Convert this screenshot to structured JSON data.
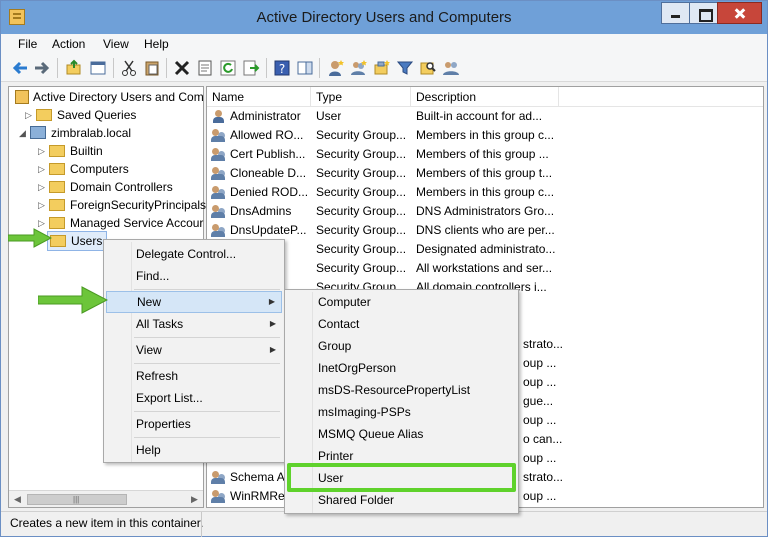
{
  "window": {
    "title": "Active Directory Users and Computers"
  },
  "menu": [
    "File",
    "Action",
    "View",
    "Help"
  ],
  "tree": {
    "root": "Active Directory Users and Com",
    "saved_queries": "Saved Queries",
    "domain": "zimbralab.local",
    "children": [
      "Builtin",
      "Computers",
      "Domain Controllers",
      "ForeignSecurityPrincipals",
      "Managed Service Accour"
    ],
    "selected": "Users"
  },
  "list": {
    "columns": [
      "Name",
      "Type",
      "Description"
    ],
    "rows": [
      {
        "name": "Administrator",
        "type": "User",
        "desc": "Built-in account for ad..."
      },
      {
        "name": "Allowed RO...",
        "type": "Security Group...",
        "desc": "Members in this group c..."
      },
      {
        "name": "Cert Publish...",
        "type": "Security Group...",
        "desc": "Members of this group ..."
      },
      {
        "name": "Cloneable D...",
        "type": "Security Group...",
        "desc": "Members of this group t..."
      },
      {
        "name": "Denied ROD...",
        "type": "Security Group...",
        "desc": "Members in this group c..."
      },
      {
        "name": "DnsAdmins",
        "type": "Security Group...",
        "desc": "DNS Administrators Gro..."
      },
      {
        "name": "DnsUpdateP...",
        "type": "Security Group...",
        "desc": "DNS clients who are per..."
      },
      {
        "name": "",
        "type": "Security Group...",
        "desc": "Designated administrato..."
      },
      {
        "name": "",
        "type": "Security Group...",
        "desc": "All workstations and ser..."
      },
      {
        "name": "",
        "type": "Security Group",
        "desc": "All domain controllers i..."
      }
    ],
    "partial_right": [
      "strato...",
      "oup ...",
      "oup ...",
      "gue...",
      "oup ...",
      "o can...",
      "oup ..."
    ],
    "bottom_rows": [
      {
        "name": "Schema A",
        "desc": "strato..."
      },
      {
        "name": "WinRMRe",
        "desc": "oup ..."
      }
    ]
  },
  "context_menu": {
    "items": [
      "Delegate Control...",
      "Find...",
      "New",
      "All Tasks",
      "View",
      "Refresh",
      "Export List...",
      "Properties",
      "Help"
    ]
  },
  "new_submenu": {
    "items": [
      "Computer",
      "Contact",
      "Group",
      "InetOrgPerson",
      "msDS-ResourcePropertyList",
      "msImaging-PSPs",
      "MSMQ Queue Alias",
      "Printer",
      "User",
      "Shared Folder"
    ]
  },
  "status": "Creates a new item in this container.",
  "colors": {
    "highlight": "#5fd22c",
    "pointer": "#6cc53a",
    "titlebar": "#6fa0d8"
  }
}
